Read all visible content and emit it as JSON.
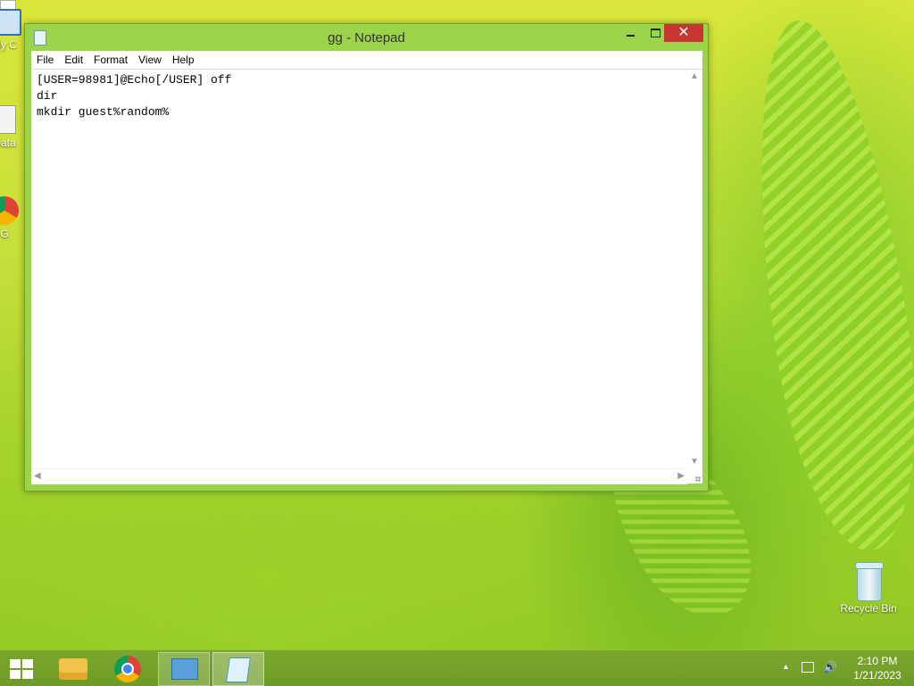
{
  "desktop": {
    "icons": [
      {
        "label": "My C"
      },
      {
        "label": "Data"
      },
      {
        "label": "G"
      },
      {
        "label": "Recycle Bin"
      }
    ]
  },
  "window": {
    "title": "gg - Notepad",
    "close_glyph": "✕",
    "menu": [
      "File",
      "Edit",
      "Format",
      "View",
      "Help"
    ],
    "content_lines": [
      "[USER=98981]@Echo[/USER] off",
      "dir",
      "mkdir guest%random%"
    ],
    "scroll_up": "▲",
    "scroll_down": "▼",
    "scroll_left": "◀",
    "scroll_right": "▶"
  },
  "taskbar": {
    "items": [
      "start",
      "file-explorer",
      "chrome",
      "control-panel",
      "notepad"
    ],
    "tray": {
      "up_arrow": "▲",
      "volume_glyph": "🔊",
      "time": "2:10 PM",
      "date": "1/21/2023"
    }
  },
  "colors": {
    "window_frame": "#9bd44a",
    "close_button": "#c7372f",
    "taskbar": "#6c9a26"
  }
}
